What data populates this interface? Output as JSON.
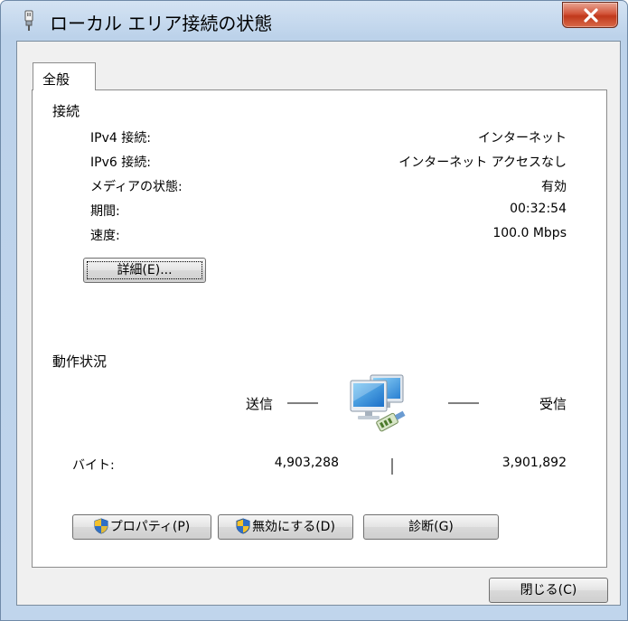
{
  "window": {
    "title": "ローカル エリア接続の状態",
    "close_label": "X"
  },
  "tabs": [
    {
      "label": "全般"
    }
  ],
  "connection": {
    "heading": "接続",
    "rows": [
      {
        "label": "IPv4 接続:",
        "value": "インターネット"
      },
      {
        "label": "IPv6 接続:",
        "value": "インターネット アクセスなし"
      },
      {
        "label": "メディアの状態:",
        "value": "有効"
      },
      {
        "label": "期間:",
        "value": "00:32:54"
      },
      {
        "label": "速度:",
        "value": "100.0 Mbps"
      }
    ],
    "details_button": "詳細(E)..."
  },
  "activity": {
    "heading": "動作状況",
    "sent_label": "送信",
    "received_label": "受信",
    "bytes_label": "バイト:",
    "bytes_sent": "4,903,288",
    "bytes_received": "3,901,892",
    "icon": "network-computers-icon"
  },
  "buttons": {
    "properties": "プロパティ(P)",
    "disable": "無効にする(D)",
    "diagnose": "診断(G)",
    "close": "閉じる(C)"
  },
  "colors": {
    "close_button": "#c7432a",
    "frame": "#c0d5ec"
  }
}
